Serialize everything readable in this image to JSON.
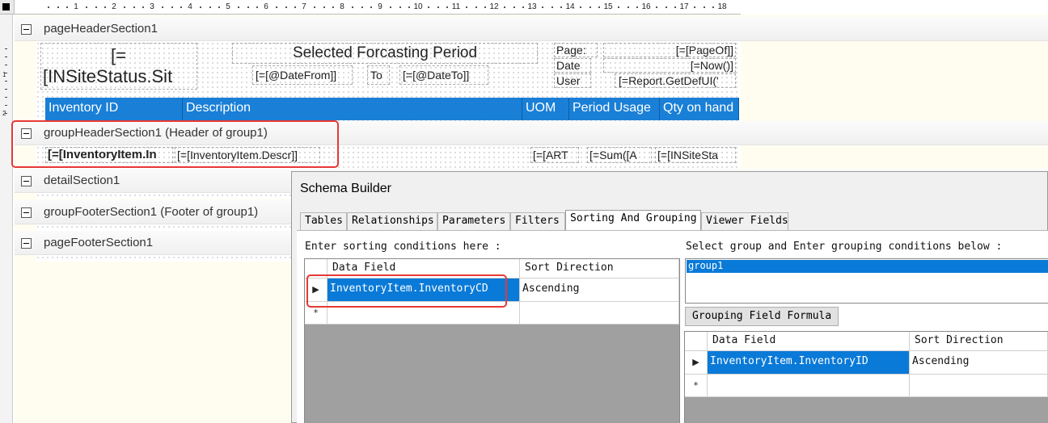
{
  "ruler": {
    "top_labels": [
      "1",
      "2",
      "3",
      "4",
      "5",
      "6",
      "7",
      "8",
      "9",
      "10",
      "11",
      "12",
      "13",
      "14",
      "15",
      "16",
      "17",
      "18"
    ],
    "left_labels": [
      "1",
      "2"
    ]
  },
  "sections": {
    "page_header": "pageHeaderSection1",
    "group_header": "groupHeaderSection1 (Header of group1)",
    "detail": "detailSection1",
    "group_footer": "groupFooterSection1 (Footer of group1)",
    "page_footer": "pageFooterSection1"
  },
  "page_header": {
    "status_line1": "[=",
    "status_line2": "[INSiteStatus.Sit",
    "title": "Selected Forcasting Period",
    "date_from": "[=[@DateFrom]]",
    "to_label": "To",
    "date_to": "[=[@DateTo]]",
    "page_label": "Page:",
    "page_value": "[=[PageOf]]",
    "date_label": "Date",
    "date_value": "[=Now()]",
    "user_label": "User",
    "user_value": "[=Report.GetDefUI('",
    "columns": [
      "Inventory ID",
      "Description",
      "UOM",
      "Period Usage",
      "Qty on hand"
    ]
  },
  "group_header": {
    "fields": [
      "[=[InventoryItem.In",
      "[=[InventoryItem.Descr]]",
      "[=[ART",
      "[=Sum([A",
      "[=[INSiteSta"
    ]
  },
  "dialog": {
    "title": "Schema Builder",
    "tabs": [
      "Tables",
      "Relationships",
      "Parameters",
      "Filters",
      "Sorting And Grouping",
      "Viewer Fields"
    ],
    "active_tab": "Sorting And Grouping",
    "sort_prompt": "Enter sorting conditions here :",
    "group_prompt": "Select group and Enter grouping conditions below :",
    "sort_grid": {
      "headers": [
        "Data Field",
        "Sort Direction"
      ],
      "rows": [
        {
          "field": "InventoryItem.InventoryCD",
          "direction": "Ascending"
        }
      ],
      "new_row_marker": "*"
    },
    "groups": [
      "group1"
    ],
    "grouping_button": "Grouping Field Formula",
    "group_grid": {
      "headers": [
        "Data Field",
        "Sort Direction"
      ],
      "rows": [
        {
          "field": "InventoryItem.InventoryID",
          "direction": "Ascending"
        }
      ],
      "new_row_marker": "*"
    }
  },
  "colors": {
    "header_blue": "#1a7fd6",
    "selection_blue": "#0a7ad8",
    "highlight_red": "#e53935",
    "designer_background": "#fffdf0"
  }
}
